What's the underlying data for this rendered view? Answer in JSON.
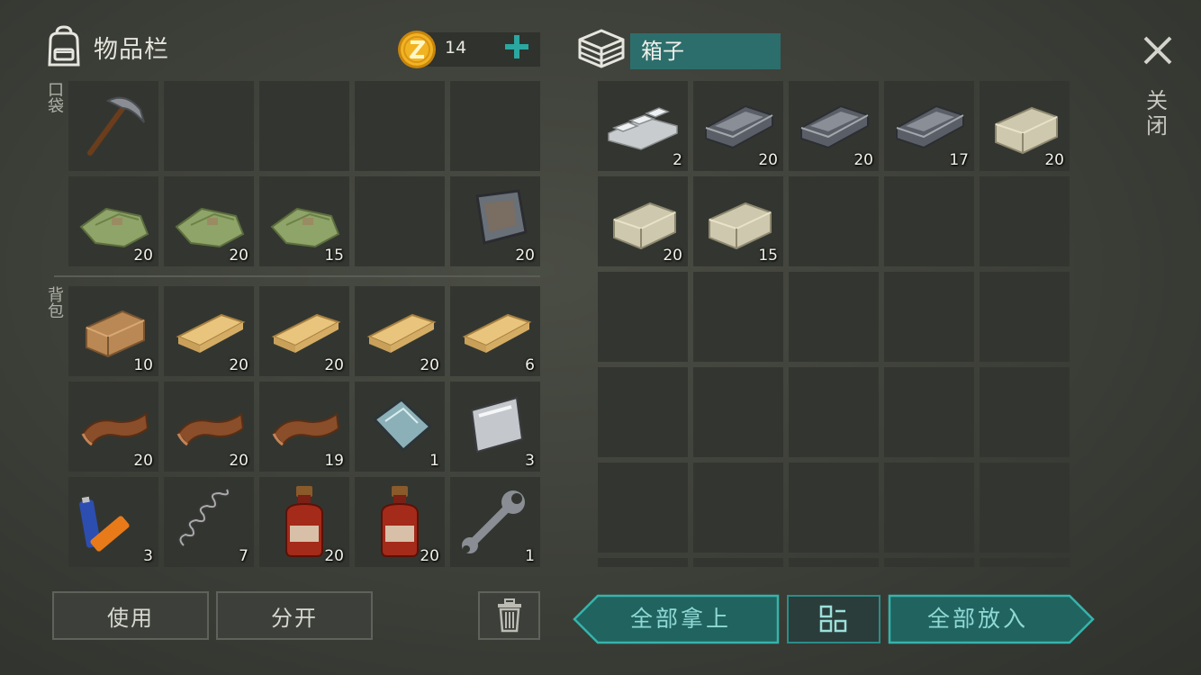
{
  "inventory": {
    "title": "物品栏",
    "coins": "14"
  },
  "sections": {
    "pocket_label": "口袋",
    "backpack_label": "背包"
  },
  "pocket_slots": [
    {
      "item": "pickaxe",
      "qty": ""
    },
    {
      "item": "empty",
      "qty": ""
    },
    {
      "item": "empty",
      "qty": ""
    },
    {
      "item": "empty",
      "qty": ""
    },
    {
      "item": "empty",
      "qty": ""
    },
    {
      "item": "cloth",
      "qty": "20"
    },
    {
      "item": "cloth",
      "qty": "20"
    },
    {
      "item": "cloth",
      "qty": "15"
    },
    {
      "item": "empty",
      "qty": ""
    },
    {
      "item": "iron-plate",
      "qty": "20"
    }
  ],
  "backpack_slots": [
    {
      "item": "log",
      "qty": "10"
    },
    {
      "item": "plank",
      "qty": "20"
    },
    {
      "item": "plank",
      "qty": "20"
    },
    {
      "item": "plank",
      "qty": "20"
    },
    {
      "item": "plank",
      "qty": "6"
    },
    {
      "item": "leather",
      "qty": "20"
    },
    {
      "item": "leather",
      "qty": "20"
    },
    {
      "item": "leather",
      "qty": "19"
    },
    {
      "item": "glass",
      "qty": "1"
    },
    {
      "item": "metal-sheet",
      "qty": "3"
    },
    {
      "item": "batteries",
      "qty": "3"
    },
    {
      "item": "spring",
      "qty": "7"
    },
    {
      "item": "spirit-bottle",
      "qty": "20"
    },
    {
      "item": "spirit-bottle",
      "qty": "20"
    },
    {
      "item": "wrench",
      "qty": "1"
    }
  ],
  "box": {
    "name": "箱子",
    "slots": [
      {
        "item": "aluminum-bars",
        "qty": "2"
      },
      {
        "item": "iron-ingot",
        "qty": "20"
      },
      {
        "item": "iron-ingot",
        "qty": "20"
      },
      {
        "item": "iron-ingot",
        "qty": "17"
      },
      {
        "item": "stone",
        "qty": "20"
      },
      {
        "item": "stone",
        "qty": "20"
      },
      {
        "item": "stone",
        "qty": "15"
      },
      {
        "item": "empty",
        "qty": ""
      },
      {
        "item": "empty",
        "qty": ""
      },
      {
        "item": "empty",
        "qty": ""
      },
      {
        "item": "empty",
        "qty": ""
      },
      {
        "item": "empty",
        "qty": ""
      },
      {
        "item": "empty",
        "qty": ""
      },
      {
        "item": "empty",
        "qty": ""
      },
      {
        "item": "empty",
        "qty": ""
      },
      {
        "item": "empty",
        "qty": ""
      },
      {
        "item": "empty",
        "qty": ""
      },
      {
        "item": "empty",
        "qty": ""
      },
      {
        "item": "empty",
        "qty": ""
      },
      {
        "item": "empty",
        "qty": ""
      },
      {
        "item": "empty",
        "qty": ""
      },
      {
        "item": "empty",
        "qty": ""
      },
      {
        "item": "empty",
        "qty": ""
      },
      {
        "item": "empty",
        "qty": ""
      },
      {
        "item": "empty",
        "qty": ""
      },
      {
        "item": "empty",
        "qty": ""
      },
      {
        "item": "empty",
        "qty": ""
      },
      {
        "item": "empty",
        "qty": ""
      },
      {
        "item": "empty",
        "qty": ""
      },
      {
        "item": "empty",
        "qty": ""
      }
    ]
  },
  "buttons": {
    "use": "使用",
    "split": "分开",
    "take_all": "全部拿上",
    "put_all": "全部放入",
    "close": "关闭"
  },
  "icons": {
    "backpack": "backpack-icon",
    "coin": "coin-icon",
    "plus": "plus-icon",
    "box": "box-icon",
    "close": "close-icon",
    "trash": "trash-icon",
    "sort": "sort-grid-icon"
  },
  "colors": {
    "accent": "#2c6e6c",
    "teal_text": "#8fd8d4",
    "plus": "#2aa7a0",
    "coin": "#f0b020"
  }
}
